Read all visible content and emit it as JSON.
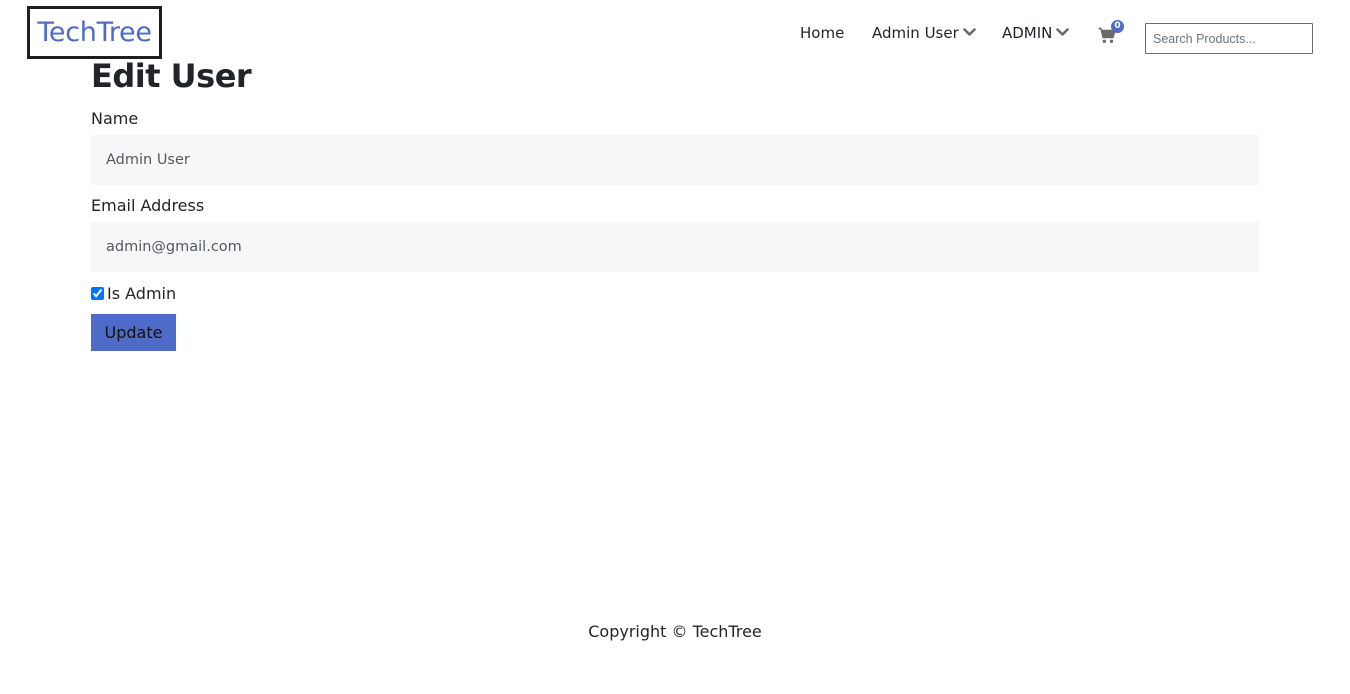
{
  "colors": {
    "accent": "#4e6bc9",
    "field_background": "#f6f7f9",
    "text": "#212529"
  },
  "header": {
    "logo": "TechTree",
    "nav": {
      "home": "Home",
      "user_menu": "Admin User",
      "admin_menu": "ADMIN"
    },
    "cart": {
      "icon": "shopping-cart-icon",
      "count": "0"
    },
    "search": {
      "placeholder": "Search Products...",
      "value": ""
    }
  },
  "form": {
    "title": "Edit User",
    "name_label": "Name",
    "name_value": "Admin User",
    "email_label": "Email Address",
    "email_value": "admin@gmail.com",
    "is_admin_label": "Is Admin",
    "is_admin_checked": true,
    "submit_label": "Update"
  },
  "footer": {
    "text": "Copyright © TechTree"
  }
}
